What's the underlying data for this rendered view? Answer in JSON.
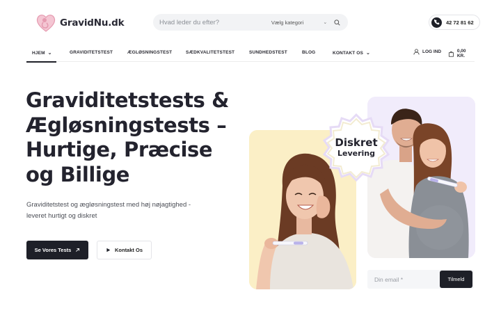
{
  "brand": {
    "name": "GravidNu.dk",
    "accent": "#e9a0b4",
    "dark": "#1e2028"
  },
  "search": {
    "placeholder": "Hvad leder du efter?",
    "category": "Vælg kategori"
  },
  "contact": {
    "phone": "42 72 81 62"
  },
  "nav": {
    "items": [
      {
        "label": "Hjem",
        "active": true,
        "dropdown": true
      },
      {
        "label": "Graviditetstest"
      },
      {
        "label": "Ægløsningstest"
      },
      {
        "label": "Sædkvalitetstest"
      },
      {
        "label": "Sundhedstest"
      },
      {
        "label": "Blog"
      },
      {
        "label": "Kontakt os",
        "dropdown": true
      }
    ],
    "login": "Log ind",
    "cart": "0,00 kr."
  },
  "hero": {
    "title_lines": [
      "Graviditetstests &",
      "Ægløsningstests –",
      "Hurtige, Præcise",
      "og Billige"
    ],
    "subtitle": "Graviditetstest og ægløsningstest med høj nøjagtighed - leveret hurtigt og diskret",
    "primary_button": "Se Vores Tests",
    "secondary_button": "Kontakt Os"
  },
  "badge": {
    "line1": "Diskret",
    "line2": "Levering"
  },
  "newsletter": {
    "placeholder": "Din email *",
    "button": "Tilmeld"
  },
  "icons": [
    "logo-heart-icon",
    "search-icon",
    "chevron-down-icon",
    "phone-icon",
    "user-icon",
    "cart-icon",
    "arrow-up-right-icon",
    "play-icon"
  ]
}
